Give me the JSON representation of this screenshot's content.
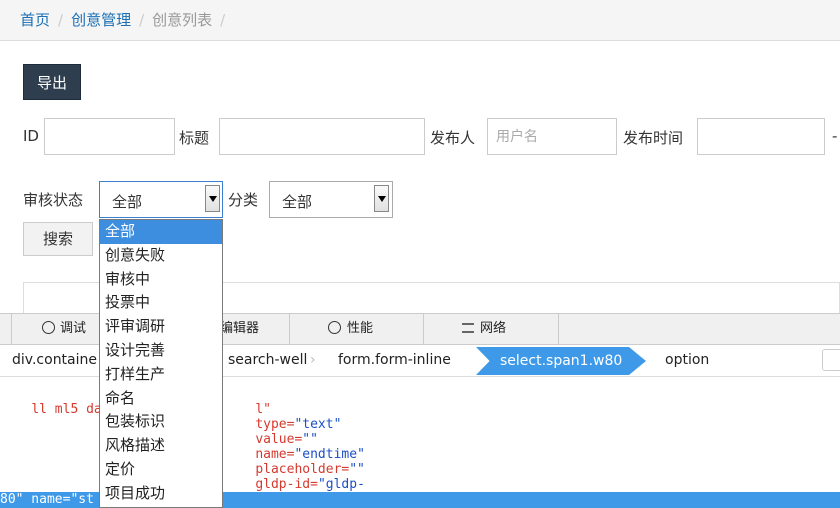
{
  "breadcrumb": {
    "home": "首页",
    "section": "创意管理",
    "current": "创意列表",
    "sep": "/"
  },
  "toolbar": {
    "export_label": "导出"
  },
  "filters": {
    "id_label": "ID",
    "title_label": "标题",
    "publisher_label": "发布人",
    "publisher_placeholder": "用户名",
    "time_label": "发布时间",
    "time_dash": "-",
    "status_label": "审核状态",
    "status_value": "全部",
    "category_label": "分类",
    "category_value": "全部",
    "search_label": "搜索"
  },
  "dropdown": {
    "options": [
      "全部",
      "创意失败",
      "审核中",
      "投票中",
      "评审调研",
      "设计完善",
      "打样生产",
      "命名",
      "包装标识",
      "风格描述",
      "定价",
      "项目成功"
    ],
    "selected_index": 0
  },
  "devtools": {
    "tabs": [
      {
        "icon": "debugger-icon",
        "label": "调试"
      },
      {
        "icon": "editor-icon",
        "label": "编辑器"
      },
      {
        "icon": "performance-icon",
        "label": "性能"
      },
      {
        "icon": "network-icon",
        "label": "网络"
      }
    ],
    "crumbs": [
      "div.containe",
      "search-well",
      "form.form-inline",
      "select.span1.w80",
      "option"
    ],
    "code": {
      "l1_a": "ll ml5 date",
      "l1_b": "l\"",
      "l1_c": "type=",
      "l1_d": "\"text\"",
      "l1_e": "value=",
      "l1_f": "\"\"",
      "l1_g": "name=",
      "l1_h": "\"endtime\"",
      "l1_i": "placeholder=",
      "l1_j": "\"\"",
      "l1_k": "gldp-id=",
      "l1_l": "\"gldp-",
      "l2": "80\" name=\"st"
    }
  },
  "colors": {
    "accent": "#3e9ae8",
    "export_bg": "#2e3e4f",
    "link": "#1a6fb5"
  }
}
